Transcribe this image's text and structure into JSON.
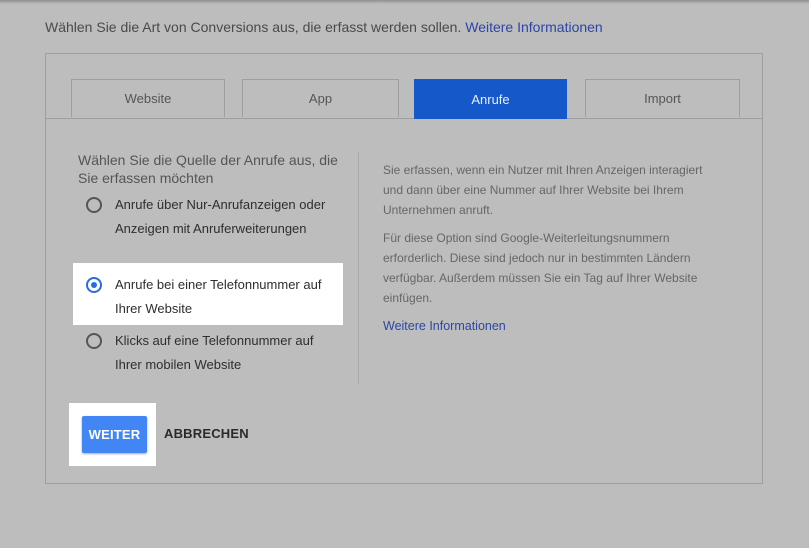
{
  "intro": {
    "text": "Wählen Sie die Art von Conversions aus, die erfasst werden sollen.",
    "link": "Weitere Informationen"
  },
  "tabs": [
    {
      "label": "Website"
    },
    {
      "label": "App"
    },
    {
      "label": "Anrufe"
    },
    {
      "label": "Import"
    }
  ],
  "source": {
    "title": "Wählen Sie die Quelle der Anrufe aus, die Sie erfassen möchten",
    "options": [
      {
        "label": "Anrufe über Nur-Anrufanzeigen oder Anzeigen mit Anruferweiterungen"
      },
      {
        "label": "Anrufe bei einer Telefonnummer auf Ihrer Website"
      },
      {
        "label": "Klicks auf eine Telefonnummer auf Ihrer mobilen Website"
      }
    ]
  },
  "info": {
    "p1": "Sie erfassen, wenn ein Nutzer mit Ihren Anzeigen interagiert und dann über eine Nummer auf Ihrer Website bei Ihrem Unternehmen anruft.",
    "p2": "Für diese Option sind Google-Weiterleitungsnummern erforderlich. Diese sind jedoch nur in bestimmten Ländern verfügbar. Außerdem müssen Sie ein Tag auf Ihrer Website einfügen.",
    "link": "Weitere Informationen"
  },
  "actions": {
    "continue": "WEITER",
    "cancel": "ABBRECHEN"
  }
}
